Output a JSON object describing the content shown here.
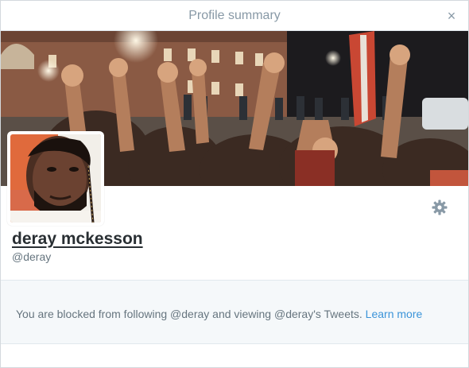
{
  "dialog": {
    "title": "Profile summary",
    "close_glyph": "×"
  },
  "profile": {
    "name": "deray mckesson",
    "handle": "@deray",
    "avatar_icon": "profile-photo",
    "banner_icon": "header-photo-protest-crowd"
  },
  "settings": {
    "icon": "gear-icon"
  },
  "blocked": {
    "message": "You are blocked from following @deray and viewing @deray's Tweets.",
    "link_label": "Learn more"
  },
  "colors": {
    "link": "#3b94d9",
    "muted_text": "#66757f",
    "title_text": "#8899a6",
    "panel_bg": "#f5f8fa"
  }
}
